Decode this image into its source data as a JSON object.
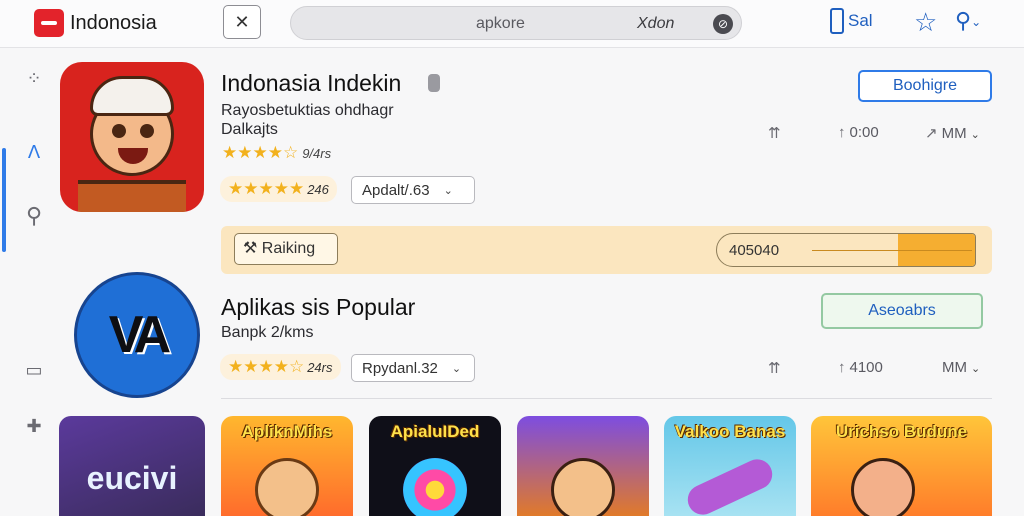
{
  "header": {
    "brand": "Indonosia",
    "close_icon_glyph": "✕",
    "search_query": "apkore",
    "search_right": "Xdon",
    "clear_glyph": "⊘",
    "phone_label": "Sal",
    "star_glyph": "☆",
    "search_glyph": "⚲",
    "chev": "⌄"
  },
  "sidebar": {
    "items": [
      {
        "icon": "dots-icon",
        "glyph": "⁘"
      },
      {
        "icon": "apps-icon",
        "glyph": "ᐱ"
      },
      {
        "icon": "search-icon",
        "glyph": "⚲"
      },
      {
        "icon": "screen-icon",
        "glyph": "▭"
      },
      {
        "icon": "puzzle-icon",
        "glyph": "✚"
      }
    ]
  },
  "apps": [
    {
      "title": "Indonasia Indekin",
      "subtitle": "Rayosbetuktias ohdhagr",
      "developer": "Dalkajts",
      "rating_stars": "★★★★☆",
      "rating_text": "9/4rs",
      "rating2_stars": "★★★★★",
      "rating2_text": "246",
      "dropdown_label": "Apdalt/.63",
      "action_label": "Boohigre",
      "stat1": "",
      "stat2": "0:00",
      "stat3": "MM"
    },
    {
      "title": "Aplikas sis Popular",
      "subtitle": "Banpk 2/kms",
      "rating_stars": "★★★★☆",
      "rating_text": "24rs",
      "dropdown_label": "Rpydanl.32",
      "action_label": "Aseoabrs",
      "stat1": "",
      "stat2": "4100",
      "stat3": "MM"
    }
  ],
  "ranking": {
    "label": "Raiking",
    "value": "405040",
    "fill_fraction": 0.7
  },
  "thumbnails": [
    {
      "label": "eucivi"
    },
    {
      "label": "ApliknMihs"
    },
    {
      "label": "ApialuIDed"
    },
    {
      "label": ""
    },
    {
      "label": "Valkoo Banas"
    },
    {
      "label": "Urichso  Budune"
    }
  ],
  "colors": {
    "accent": "#2f7be8",
    "brand_red": "#e3232b",
    "star": "#f2b11d",
    "ranking_bg": "#fbe6bf",
    "ranking_fill": "#f5ae31"
  }
}
